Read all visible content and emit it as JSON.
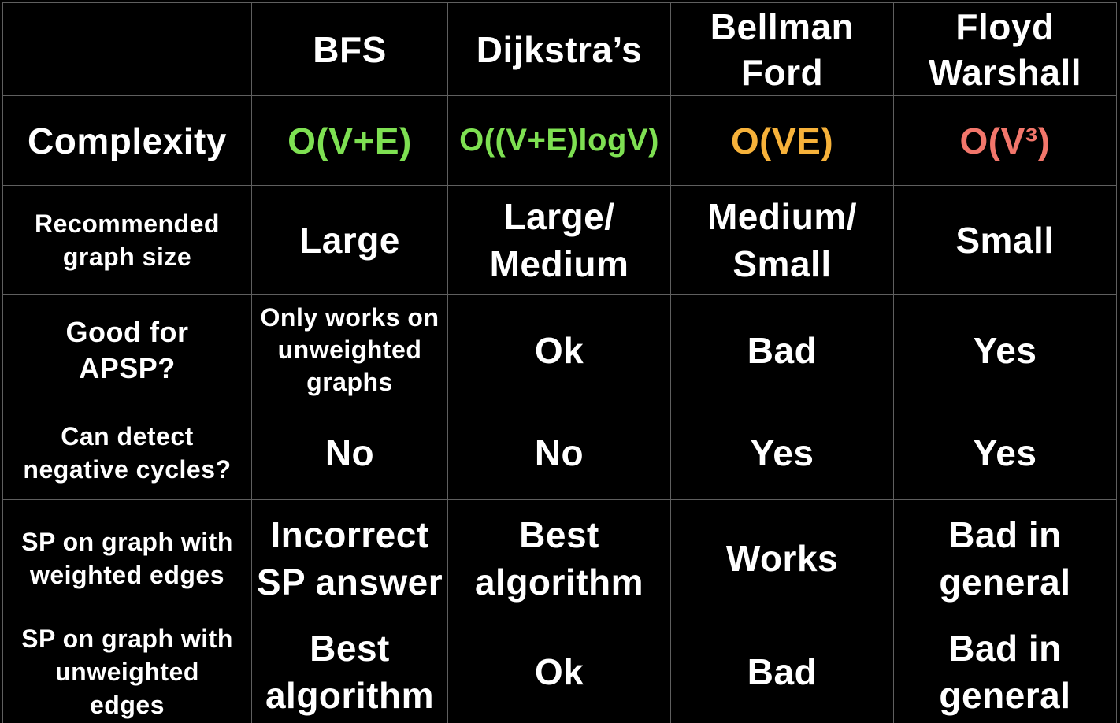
{
  "table": {
    "headers": [
      "",
      "BFS",
      "Dijkstra’s",
      "Bellman Ford",
      "Floyd Warshall"
    ],
    "header_lines": {
      "bellman": [
        "Bellman",
        "Ford"
      ],
      "floyd": [
        "Floyd",
        "Warshall"
      ]
    },
    "rows": [
      {
        "label": "Complexity",
        "cells": [
          "O(V+E)",
          "O((V+E)logV)",
          "O(VE)",
          "O(V³)"
        ],
        "cell_colors": [
          "#7ee052",
          "#7ee052",
          "#f7b23a",
          "#f2766b"
        ]
      },
      {
        "label_lines": [
          "Recommended",
          "graph size"
        ],
        "cells": [
          [
            "Large"
          ],
          [
            "Large/",
            "Medium"
          ],
          [
            "Medium/",
            "Small"
          ],
          [
            "Small"
          ]
        ]
      },
      {
        "label_lines": [
          "Good for",
          "APSP?"
        ],
        "cells": [
          [
            "Only works on",
            "unweighted",
            "graphs"
          ],
          [
            "Ok"
          ],
          [
            "Bad"
          ],
          [
            "Yes"
          ]
        ]
      },
      {
        "label_lines": [
          "Can detect",
          "negative cycles?"
        ],
        "cells": [
          [
            "No"
          ],
          [
            "No"
          ],
          [
            "Yes"
          ],
          [
            "Yes"
          ]
        ]
      },
      {
        "label_lines": [
          "SP on graph with",
          "weighted edges"
        ],
        "cells": [
          [
            "Incorrect",
            "SP answer"
          ],
          [
            "Best",
            "algorithm"
          ],
          [
            "Works"
          ],
          [
            "Bad in",
            "general"
          ]
        ]
      },
      {
        "label_lines": [
          "SP on graph with",
          "unweighted",
          "edges"
        ],
        "cells": [
          [
            "Best",
            "algorithm"
          ],
          [
            "Ok"
          ],
          [
            "Bad"
          ],
          [
            "Bad in",
            "general"
          ]
        ]
      }
    ]
  }
}
